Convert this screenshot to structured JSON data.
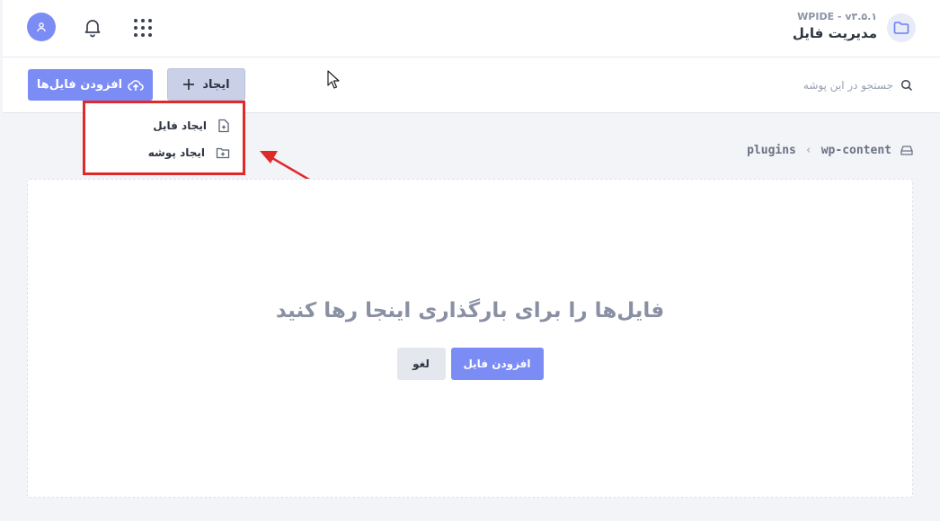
{
  "header": {
    "app_title": "WPIDE - v۳.۵.۱",
    "app_subtitle": "مدیریت فایل",
    "icons": [
      "folder-icon",
      "user-icon",
      "bell-icon",
      "apps-grid-icon"
    ]
  },
  "toolbar": {
    "upload_label": "افزودن فایل‌ها",
    "create_label": "ایجاد",
    "search_placeholder": "جستجو در این پوشه"
  },
  "create_menu": {
    "items": [
      {
        "label": "ایجاد فایل",
        "icon": "file-plus-icon"
      },
      {
        "label": "ایجاد پوشه",
        "icon": "folder-plus-icon"
      }
    ]
  },
  "breadcrumb": {
    "items": [
      "wp-content",
      "plugins"
    ]
  },
  "dropzone": {
    "title": "فایل‌ها را برای بارگذاری اینجا رها کنید",
    "add_label": "افزودن فایل",
    "cancel_label": "لغو"
  },
  "colors": {
    "accent": "#7b8cf5",
    "highlight": "#e02a2a",
    "background": "#f3f4f7"
  }
}
